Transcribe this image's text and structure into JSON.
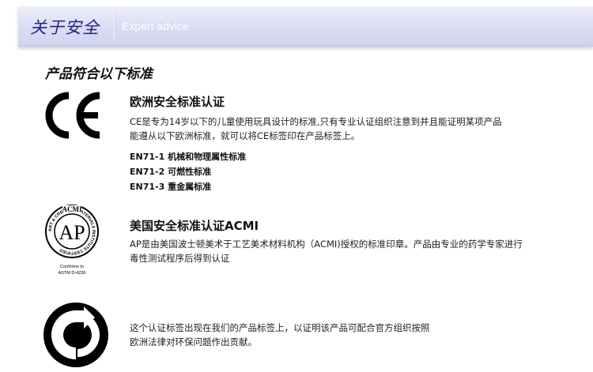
{
  "header": {
    "title": "关于安全",
    "subtitle": "Expert advice"
  },
  "section_title": "产品符合以下标准",
  "ce": {
    "logo_text": "CE",
    "title": "欧洲安全标准认证",
    "desc_line1": "CE是专为14岁以下的儿童使用玩具设计的标准,只有专业认证组织注意到并且能证明某项产品",
    "desc_line2": "能遵从以下欧洲标准，就可以将CE标签印在产品标签上。",
    "standards": [
      "EN71-1 机械和物理属性标准",
      "EN71-2 可燃性标准",
      "EN71-3 重金属标准"
    ]
  },
  "acmi": {
    "logo_top": "ACMI",
    "logo_ring": "ART & CREATIVE MATERIALS INSTITUTE CERTIFIED",
    "logo_center": "AP",
    "logo_bottom1": "Conforms to",
    "logo_bottom2": "ASTM D-4236",
    "title": "美国安全标准认证ACMI",
    "desc_line1": "AP是由美国波士顿美术于工艺美术材料机构（ACMI)授权的标准印章。产品由专业的药学专家进行",
    "desc_line2": "毒性测试程序后得到认证"
  },
  "green": {
    "desc_line1": "这个认证标签出现在我们的产品标签上，以证明该产品可配合官方组织按照",
    "desc_line2": "欧洲法律对环保问题作出贡献。"
  }
}
